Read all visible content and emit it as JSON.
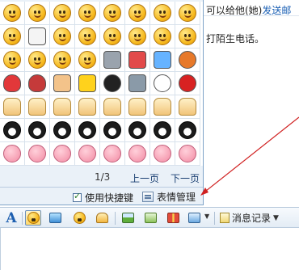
{
  "background": {
    "line1_prefix": "可以给他(她)",
    "line1_link": "发送邮",
    "line2": "打陌生电话。"
  },
  "picker": {
    "page_indicator": "1/3",
    "prev_label": "上一页",
    "next_label": "下一页",
    "shortcut_label": "使用快捷键",
    "shortcut_checked": true,
    "manage_label": "表情管理"
  },
  "toolbar": {
    "font_label": "A",
    "history_label": "消息记录"
  },
  "emoticons": [
    [
      "smile-face",
      "laugh-face",
      "frown-face",
      "wink-face",
      "grin-face",
      "angry-face",
      "squint-face",
      "sly-face",
      "helmet-face"
    ],
    [
      "sweat-face",
      "skull",
      "pirate-face",
      "bored-face",
      "shy-face",
      "hush-face",
      "tongue-face",
      "cry-face",
      "grimace-face"
    ],
    [
      "cool-face",
      "sleepy-face",
      "eyes-face",
      "thinking-face",
      "knife",
      "watermelon",
      "drink-cup",
      "basketball",
      "ping-pong"
    ],
    [
      "heart",
      "broken-heart",
      "cake",
      "lightning",
      "bomb",
      "dagger",
      "soccer-ball",
      "ladybug",
      "poop"
    ],
    [
      "hug",
      "victory-hand",
      "thumbs-down",
      "handshake",
      "fist",
      "rock-hand",
      "pinky-hand",
      "ok-hand"
    ],
    [
      "qq-penguin",
      "qq-penguin",
      "qq-penguin",
      "qq-penguin",
      "qq-penguin",
      "qq-penguin",
      "qq-penguin",
      "qq-penguin"
    ],
    [
      "pig-face",
      "pig-face",
      "pig-face",
      "pig-face",
      "pig-face",
      "pig-face",
      "pig-face",
      "pig-face"
    ]
  ],
  "colors": {
    "accent_link": "#1a5fb4",
    "annotation_arrow": "#d02020",
    "panel_bg": "#eaf1f8"
  }
}
